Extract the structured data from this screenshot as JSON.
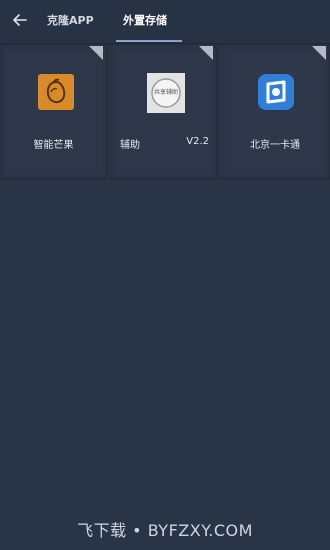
{
  "header": {
    "tabs": [
      {
        "label": "克隆APP"
      },
      {
        "label": "外置存储"
      }
    ],
    "active_tab": "外置存储"
  },
  "apps": [
    {
      "label": "智能芒果",
      "icon": "mango-app-icon"
    },
    {
      "label_left": "辅助",
      "label_right": "V2.2",
      "icon": "assistant-app-icon",
      "icon_text": "共享辅助"
    },
    {
      "label": "北京一卡通",
      "icon": "beijing-card-app-icon"
    }
  ],
  "watermark": "飞下载 • BYFZXY.COM",
  "colors": {
    "background": "#2a3447",
    "tab_underline": "#8fa3c6",
    "mango_icon": "#d98b2b",
    "card_icon": "#2f7fd8"
  }
}
